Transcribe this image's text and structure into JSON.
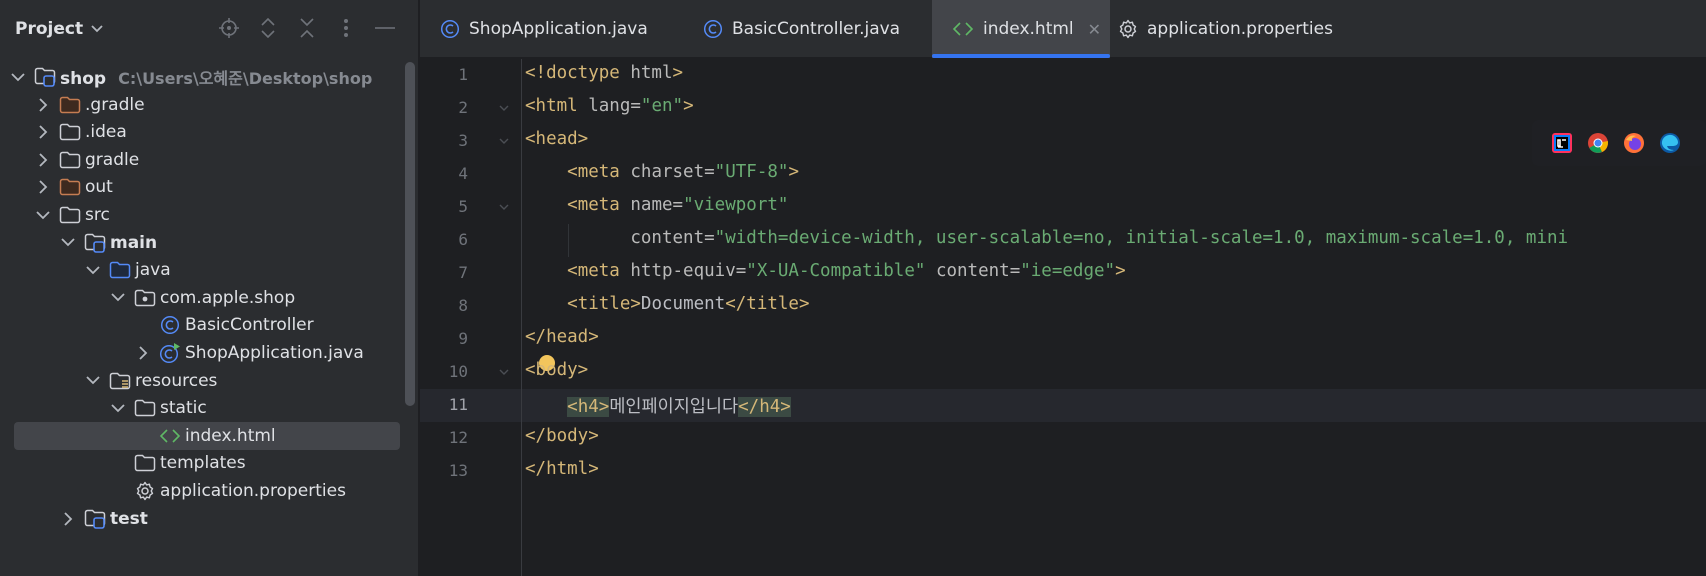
{
  "project_pane": {
    "title": "Project",
    "tools": [
      "locate-icon",
      "expand-all-icon",
      "collapse-all-icon",
      "options-icon",
      "hide-icon"
    ]
  },
  "tree": [
    {
      "id": "shop",
      "label": "shop",
      "hint": "C:\\Users\\오혜준\\Desktop\\shop",
      "depth": 0,
      "arrow": "down",
      "icon": "module-folder",
      "bold": true
    },
    {
      "id": "gradle-hidden",
      "label": ".gradle",
      "depth": 1,
      "arrow": "right",
      "icon": "folder-orange"
    },
    {
      "id": "idea",
      "label": ".idea",
      "depth": 1,
      "arrow": "right",
      "icon": "folder"
    },
    {
      "id": "gradle",
      "label": "gradle",
      "depth": 1,
      "arrow": "right",
      "icon": "folder"
    },
    {
      "id": "out",
      "label": "out",
      "depth": 1,
      "arrow": "right",
      "icon": "folder-orange"
    },
    {
      "id": "src",
      "label": "src",
      "depth": 1,
      "arrow": "down",
      "icon": "folder"
    },
    {
      "id": "main",
      "label": "main",
      "depth": 2,
      "arrow": "down",
      "icon": "module-folder",
      "bold": true
    },
    {
      "id": "java",
      "label": "java",
      "depth": 3,
      "arrow": "down",
      "icon": "folder-blue"
    },
    {
      "id": "com-apple-shop",
      "label": "com.apple.shop",
      "depth": 4,
      "arrow": "down",
      "icon": "package"
    },
    {
      "id": "basic-controller",
      "label": "BasicController",
      "depth": 5,
      "arrow": "none",
      "icon": "class"
    },
    {
      "id": "shop-application",
      "label": "ShopApplication.java",
      "depth": 5,
      "arrow": "right",
      "icon": "class-run"
    },
    {
      "id": "resources",
      "label": "resources",
      "depth": 3,
      "arrow": "down",
      "icon": "resources-folder"
    },
    {
      "id": "static",
      "label": "static",
      "depth": 4,
      "arrow": "down",
      "icon": "folder"
    },
    {
      "id": "index-html",
      "label": "index.html",
      "depth": 5,
      "arrow": "none",
      "icon": "html",
      "selected": true
    },
    {
      "id": "templates",
      "label": "templates",
      "depth": 4,
      "arrow": "none",
      "icon": "folder"
    },
    {
      "id": "application-properties",
      "label": "application.properties",
      "depth": 4,
      "arrow": "none",
      "icon": "gear"
    },
    {
      "id": "test",
      "label": "test",
      "depth": 2,
      "arrow": "right",
      "icon": "module-folder",
      "bold": true
    }
  ],
  "tabs": [
    {
      "label": "ShopApplication.java",
      "icon": "class",
      "active": false
    },
    {
      "label": "BasicController.java",
      "icon": "class",
      "active": false
    },
    {
      "label": "index.html",
      "icon": "html",
      "active": true,
      "close": "✕"
    },
    {
      "label": "application.properties",
      "icon": "gear",
      "active": false
    }
  ],
  "editor": {
    "current_line": 11,
    "lines": [
      [
        [
          "tag",
          "<!doctype "
        ],
        [
          "attr",
          "html"
        ],
        [
          "tag",
          ">"
        ]
      ],
      [
        [
          "tag",
          "<html "
        ],
        [
          "attr",
          "lang="
        ],
        [
          "str",
          "\"en\""
        ],
        [
          "tag",
          ">"
        ]
      ],
      [
        [
          "tag",
          "<head>"
        ]
      ],
      [
        [
          "txt",
          "    "
        ],
        [
          "tag",
          "<meta "
        ],
        [
          "attr",
          "charset="
        ],
        [
          "str",
          "\"UTF-8\""
        ],
        [
          "tag",
          ">"
        ]
      ],
      [
        [
          "txt",
          "    "
        ],
        [
          "tag",
          "<meta "
        ],
        [
          "attr",
          "name="
        ],
        [
          "str",
          "\"viewport\""
        ]
      ],
      [
        [
          "txt",
          "          "
        ],
        [
          "attr",
          "content="
        ],
        [
          "str",
          "\"width=device-width, user-scalable=no, initial-scale=1.0, maximum-scale=1.0, mini"
        ]
      ],
      [
        [
          "txt",
          "    "
        ],
        [
          "tag",
          "<meta "
        ],
        [
          "attr",
          "http-equiv="
        ],
        [
          "str",
          "\"X-UA-Compatible\" "
        ],
        [
          "attr",
          "content="
        ],
        [
          "str",
          "\"ie=edge\""
        ],
        [
          "tag",
          ">"
        ]
      ],
      [
        [
          "txt",
          "    "
        ],
        [
          "tag",
          "<title>"
        ],
        [
          "txt",
          "Document"
        ],
        [
          "tag",
          "</title>"
        ]
      ],
      [
        [
          "tag",
          "</head>"
        ]
      ],
      [
        [
          "tag",
          "<body>"
        ]
      ],
      [
        [
          "txt",
          "    "
        ],
        [
          "tag-hl",
          "<h4>"
        ],
        [
          "txt",
          "메인페이지입니다"
        ],
        [
          "tag-hl",
          "</h4>"
        ]
      ],
      [
        [
          "tag",
          "</body>"
        ]
      ],
      [
        [
          "tag",
          "</html>"
        ]
      ]
    ],
    "fold_lines": [
      2,
      3,
      5,
      10
    ],
    "browser_icons": [
      "intellij-icon",
      "chrome-icon",
      "firefox-icon",
      "edge-icon"
    ]
  },
  "colors": {
    "accent": "#3574f0",
    "tag": "#d5b778",
    "string": "#6aab73"
  }
}
